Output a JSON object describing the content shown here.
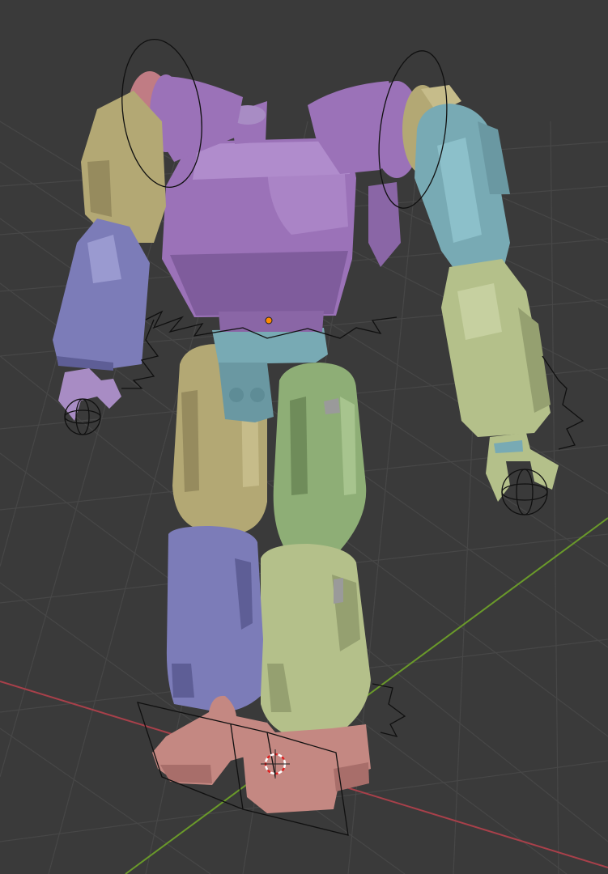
{
  "viewport": {
    "background": "#3a3a3a",
    "grid_color": "#474747",
    "x_axis_color": "#a8404a",
    "y_axis_color": "#6a9a2a"
  },
  "robot": {
    "colors": {
      "purple": "#9b72b8",
      "purple_dark": "#7f5c9c",
      "tan": "#b3a874",
      "teal": "#78aab4",
      "slate": "#7c7cb8",
      "green": "#8eae76",
      "lime": "#b4c08a",
      "pink": "#c07c84",
      "salmon": "#c48882",
      "lavender": "#a88cc4"
    }
  },
  "gizmos": {
    "wire_color": "#101010",
    "origin_color": "#ff8a00",
    "cursor_primary": "#ffffff",
    "cursor_secondary": "#e02020"
  }
}
